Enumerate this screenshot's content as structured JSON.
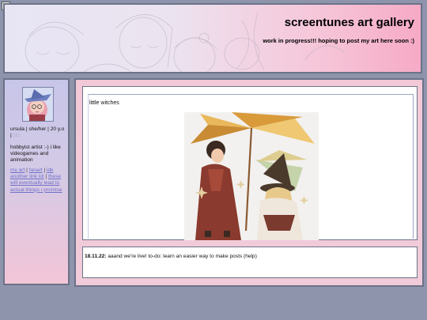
{
  "header": {
    "title": "screentunes art gallery",
    "subtitle": "work in progress!!! hoping to post my art here soon :)"
  },
  "sidebar": {
    "bio_line": "ursula | she/her | 20 y.o |",
    "bio_flags": "□□",
    "about": "hobbyist artist :-) i like videogames and animation",
    "links": [
      {
        "label": "my art"
      },
      {
        "label": "fanart"
      },
      {
        "label": "idk another link lol"
      },
      {
        "label": "these will eventually lead to actual things i promise"
      }
    ],
    "separator": "|"
  },
  "post": {
    "title": "little witches"
  },
  "update": {
    "date": "18.11.22:",
    "text": "aaand we're live! to-do: learn an easier way to make posts (help)"
  },
  "colors": {
    "page_bg": "#8d94ac",
    "border": "#6c7388",
    "link": "#6f70c9",
    "header_pink": "#f6aac6",
    "panel_lavender": "#c7c5e9"
  }
}
